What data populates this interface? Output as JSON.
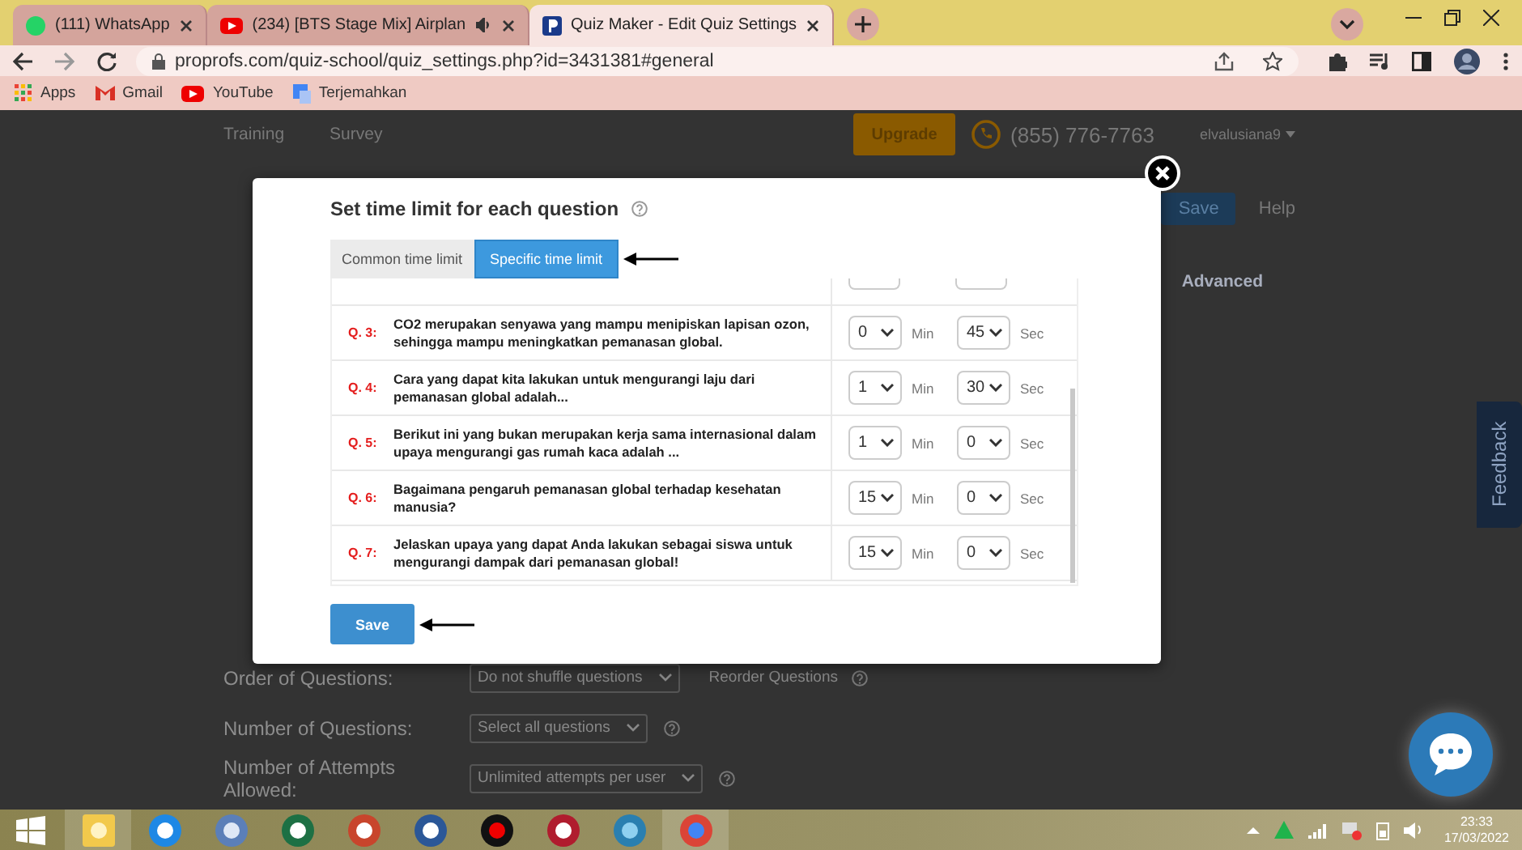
{
  "browser": {
    "tabs": [
      {
        "title": "(111) WhatsApp",
        "audio": false,
        "selected": false
      },
      {
        "title": "(234) [BTS Stage Mix] Airplan",
        "audio": true,
        "selected": false
      },
      {
        "title": "Quiz Maker - Edit Quiz Settings",
        "audio": false,
        "selected": true
      }
    ],
    "url": "proprofs.com/quiz-school/quiz_settings.php?id=3431381#general",
    "bookmarks": [
      "Apps",
      "Gmail",
      "YouTube",
      "Terjemahkan"
    ]
  },
  "page": {
    "nav": [
      "Training",
      "Survey"
    ],
    "upgrade": "Upgrade",
    "phone": "(855) 776-7763",
    "user": "elvalusiana9",
    "header_buttons": [
      {
        "label": "Save",
        "kind": "primary"
      },
      {
        "label": "Help",
        "kind": "link"
      }
    ],
    "tab": "Advanced",
    "settings": [
      {
        "label": "Order of Questions:",
        "value": "Do not shuffle questions",
        "link": "Reorder Questions"
      },
      {
        "label": "Number of Questions:",
        "value": "Select all questions"
      },
      {
        "label": "Number of Attempts Allowed:",
        "value": "Unlimited attempts per user"
      }
    ],
    "feedback": "Feedback"
  },
  "modal": {
    "title": "Set time limit for each question",
    "mode_tabs": [
      {
        "label": "Common time limit",
        "selected": false
      },
      {
        "label": "Specific time limit",
        "selected": true
      }
    ],
    "questions": [
      {
        "number": "Q. 3:",
        "text": "CO2 merupakan senyawa yang mampu menipiskan lapisan ozon, sehingga mampu meningkatkan pemanasan global.",
        "minutes": "0",
        "min_unit": "Min",
        "seconds": "45",
        "sec_unit": "Sec"
      },
      {
        "number": "Q. 4:",
        "text": "Cara yang dapat kita lakukan untuk mengurangi laju dari pemanasan global adalah...",
        "minutes": "1",
        "min_unit": "Min",
        "seconds": "30",
        "sec_unit": "Sec"
      },
      {
        "number": "Q. 5:",
        "text": "Berikut ini yang bukan merupakan kerja sama internasional dalam upaya mengurangi gas rumah kaca adalah ...",
        "minutes": "1",
        "min_unit": "Min",
        "seconds": "0",
        "sec_unit": "Sec"
      },
      {
        "number": "Q. 6:",
        "text": "Bagaimana pengaruh pemanasan global terhadap kesehatan manusia?",
        "minutes": "15",
        "min_unit": "Min",
        "seconds": "0",
        "sec_unit": "Sec"
      },
      {
        "number": "Q. 7:",
        "text": "Jelaskan upaya yang dapat Anda lakukan sebagai siswa untuk mengurangi dampak dari pemanasan global!",
        "minutes": "15",
        "min_unit": "Min",
        "seconds": "0",
        "sec_unit": "Sec"
      }
    ],
    "save": "Save"
  },
  "taskbar": {
    "time": "23:33",
    "date": "17/03/2022"
  }
}
